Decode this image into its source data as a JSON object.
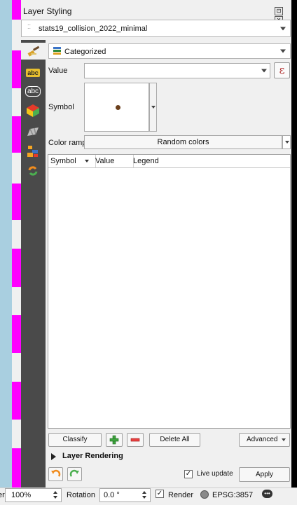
{
  "panel": {
    "title": "Layer Styling",
    "layer_name": "stats19_collision_2022_minimal",
    "renderer": "Categorized"
  },
  "sidebar": {
    "icons": [
      "paintbrush-icon",
      "label-abc-icon",
      "label-abc-outline-icon",
      "3d-cube-icon",
      "diagram-icon",
      "layers-order-icon",
      "history-icon"
    ]
  },
  "fields": {
    "value_label": "Value",
    "value": "",
    "expression_symbol": "ε",
    "symbol_label": "Symbol",
    "color_ramp_label": "Color ramp",
    "color_ramp_value": "Random colors"
  },
  "table": {
    "columns": [
      "Symbol",
      "Value",
      "Legend"
    ],
    "rows": []
  },
  "buttons": {
    "classify": "Classify",
    "delete_all": "Delete All",
    "advanced": "Advanced",
    "apply": "Apply",
    "live_update": "Live update"
  },
  "sections": {
    "layer_rendering": "Layer Rendering"
  },
  "statusbar": {
    "magnifier_label": "er",
    "magnifier_value": "100%",
    "rotation_label": "Rotation",
    "rotation_value": "0.0 °",
    "render_label": "Render",
    "crs": "EPSG:3857"
  },
  "colors": {
    "symbol_fill": "#6b3f1c",
    "sidebar_bg": "#4a4a4a",
    "window_edge": "#a9cfe0",
    "marker": "#ff00ff"
  }
}
